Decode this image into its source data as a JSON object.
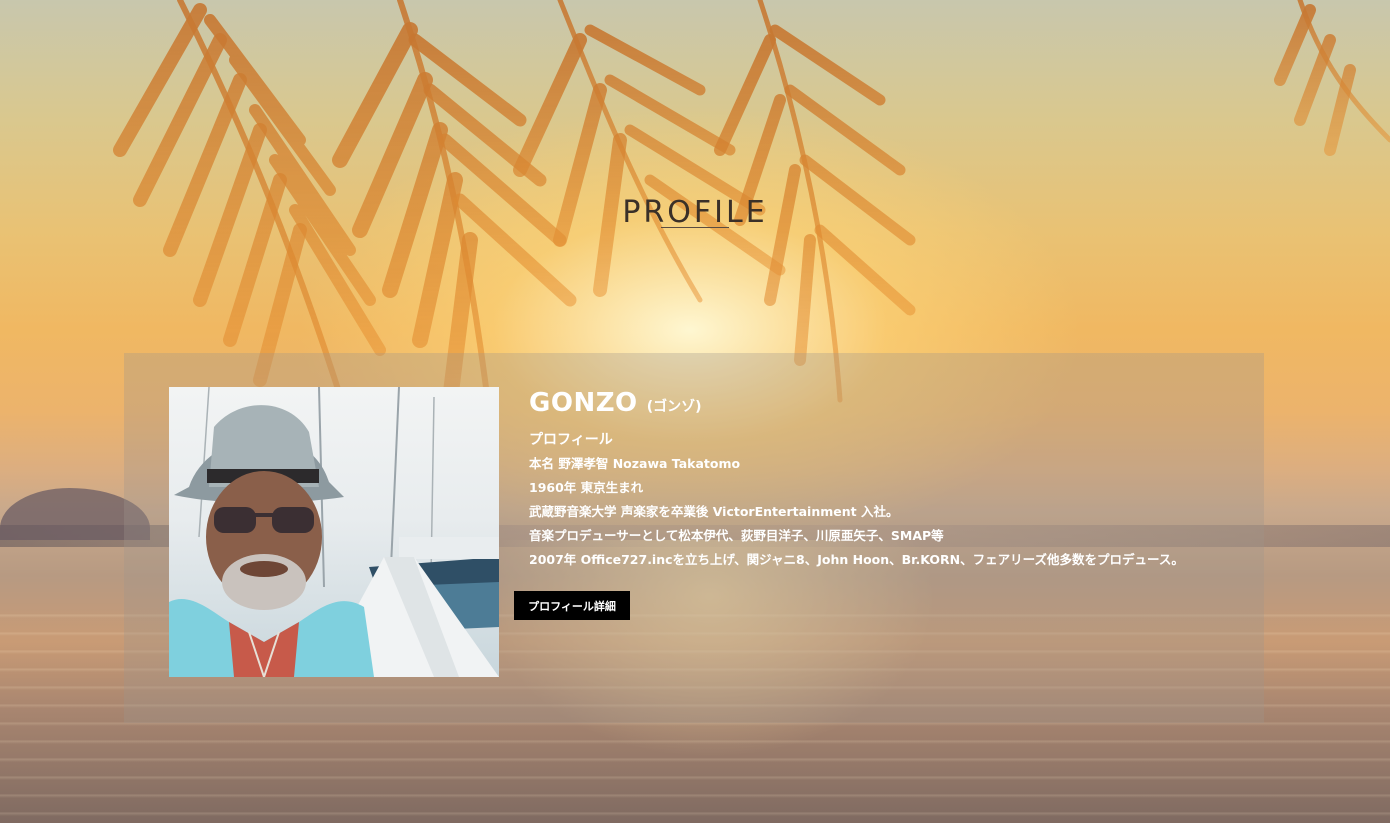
{
  "section": {
    "title": "PROFILE"
  },
  "profile": {
    "name": "GONZO",
    "name_kana": "(ゴンゾ)",
    "heading": "プロフィール",
    "lines": [
      "本名 野澤孝智 Nozawa Takatomo",
      "1960年 東京生まれ",
      "武蔵野音楽大学 声楽家を卒業後 VictorEntertainment 入社。",
      "音楽プロデューサーとして松本伊代、荻野目洋子、川原亜矢子、SMAP等",
      "2007年 Office727.incを立ち上げ、関ジャニ8、John Hoon、Br.KORN、フェアリーズ他多数をプロデュース。"
    ],
    "detail_button_label": "プロフィール詳細",
    "photo_icon": "portrait-photo"
  },
  "colors": {
    "title": "#3a3028",
    "button_bg": "#000000",
    "text": "#ffffff"
  }
}
